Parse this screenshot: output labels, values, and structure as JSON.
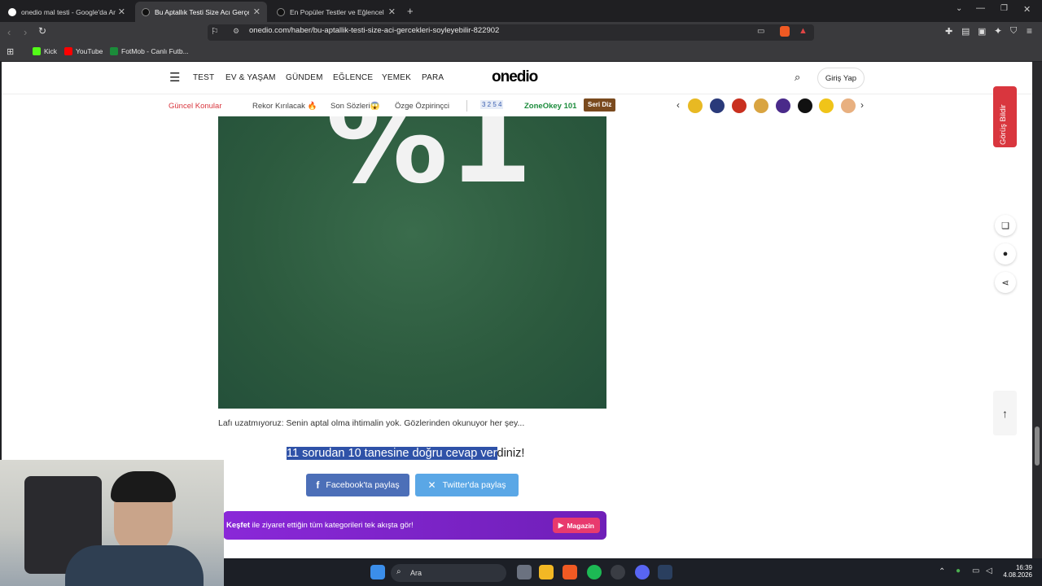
{
  "browser": {
    "tabs": [
      {
        "title": "onedio mal testi - Google'da Ara",
        "active": false
      },
      {
        "title": "Bu Aptallık Testi Size Acı Gerçekle",
        "active": true
      },
      {
        "title": "En Popüler Testler ve Eğlenceli Quizle",
        "active": false
      }
    ],
    "url": "onedio.com/haber/bu-aptallik-testi-size-aci-gercekleri-soyleyebilir-822902",
    "bookmarks": [
      "Kick",
      "YouTube",
      "FotMob - Canlı Futb..."
    ],
    "new_tab_glyph": "+",
    "bookmark_colors": [
      "#53fc18",
      "#ff0000",
      "#1b8c3a"
    ]
  },
  "site": {
    "logo": "onedio",
    "nav": [
      "TEST",
      "EV & YAŞAM",
      "GÜNDEM",
      "EĞLENCE",
      "YEMEK",
      "PARA"
    ],
    "login": "Giriş Yap",
    "subnav": {
      "current": "Güncel Konular",
      "links": [
        "Rekor Kırılacak 🔥",
        "Son Sözleri😱",
        "Özge Özpirinçci"
      ],
      "zone_digits": "3 2 5 4",
      "zone": "ZoneOkey 101",
      "badge": "Seri Diz"
    },
    "stories_colors": [
      "#e8b923",
      "#2a3a7a",
      "#c9301f",
      "#d9a441",
      "#4a2a8a",
      "#111111",
      "#f0c419",
      "#e8b080"
    ]
  },
  "article": {
    "image_text_percent": "%",
    "image_text_number": "1",
    "caption": "Lafı uzatmıyoruz: Senin aptal olma ihtimalin yok.  Gözlerinden okunuyor her şey...",
    "result_highlight": "11 sorudan 10 tanesine doğru cevap ver",
    "result_rest": "diniz!",
    "facebook": "Facebook'ta paylaş",
    "twitter": "Twitter'da paylaş",
    "banner_bold": "Keşfet",
    "banner_text": " ile ziyaret ettiğin tüm kategorileri tek akışta gör!",
    "magazin": "Magazin"
  },
  "rail": {
    "feedback": "Görüş Bildir"
  },
  "taskbar": {
    "search": "Ara",
    "time": "16:39",
    "date": "4.08.2026"
  },
  "colors": {
    "accent": "#d9363e",
    "facebook": "#4267b2",
    "twitter": "#1da1f2",
    "banner": "#7b22c9"
  }
}
